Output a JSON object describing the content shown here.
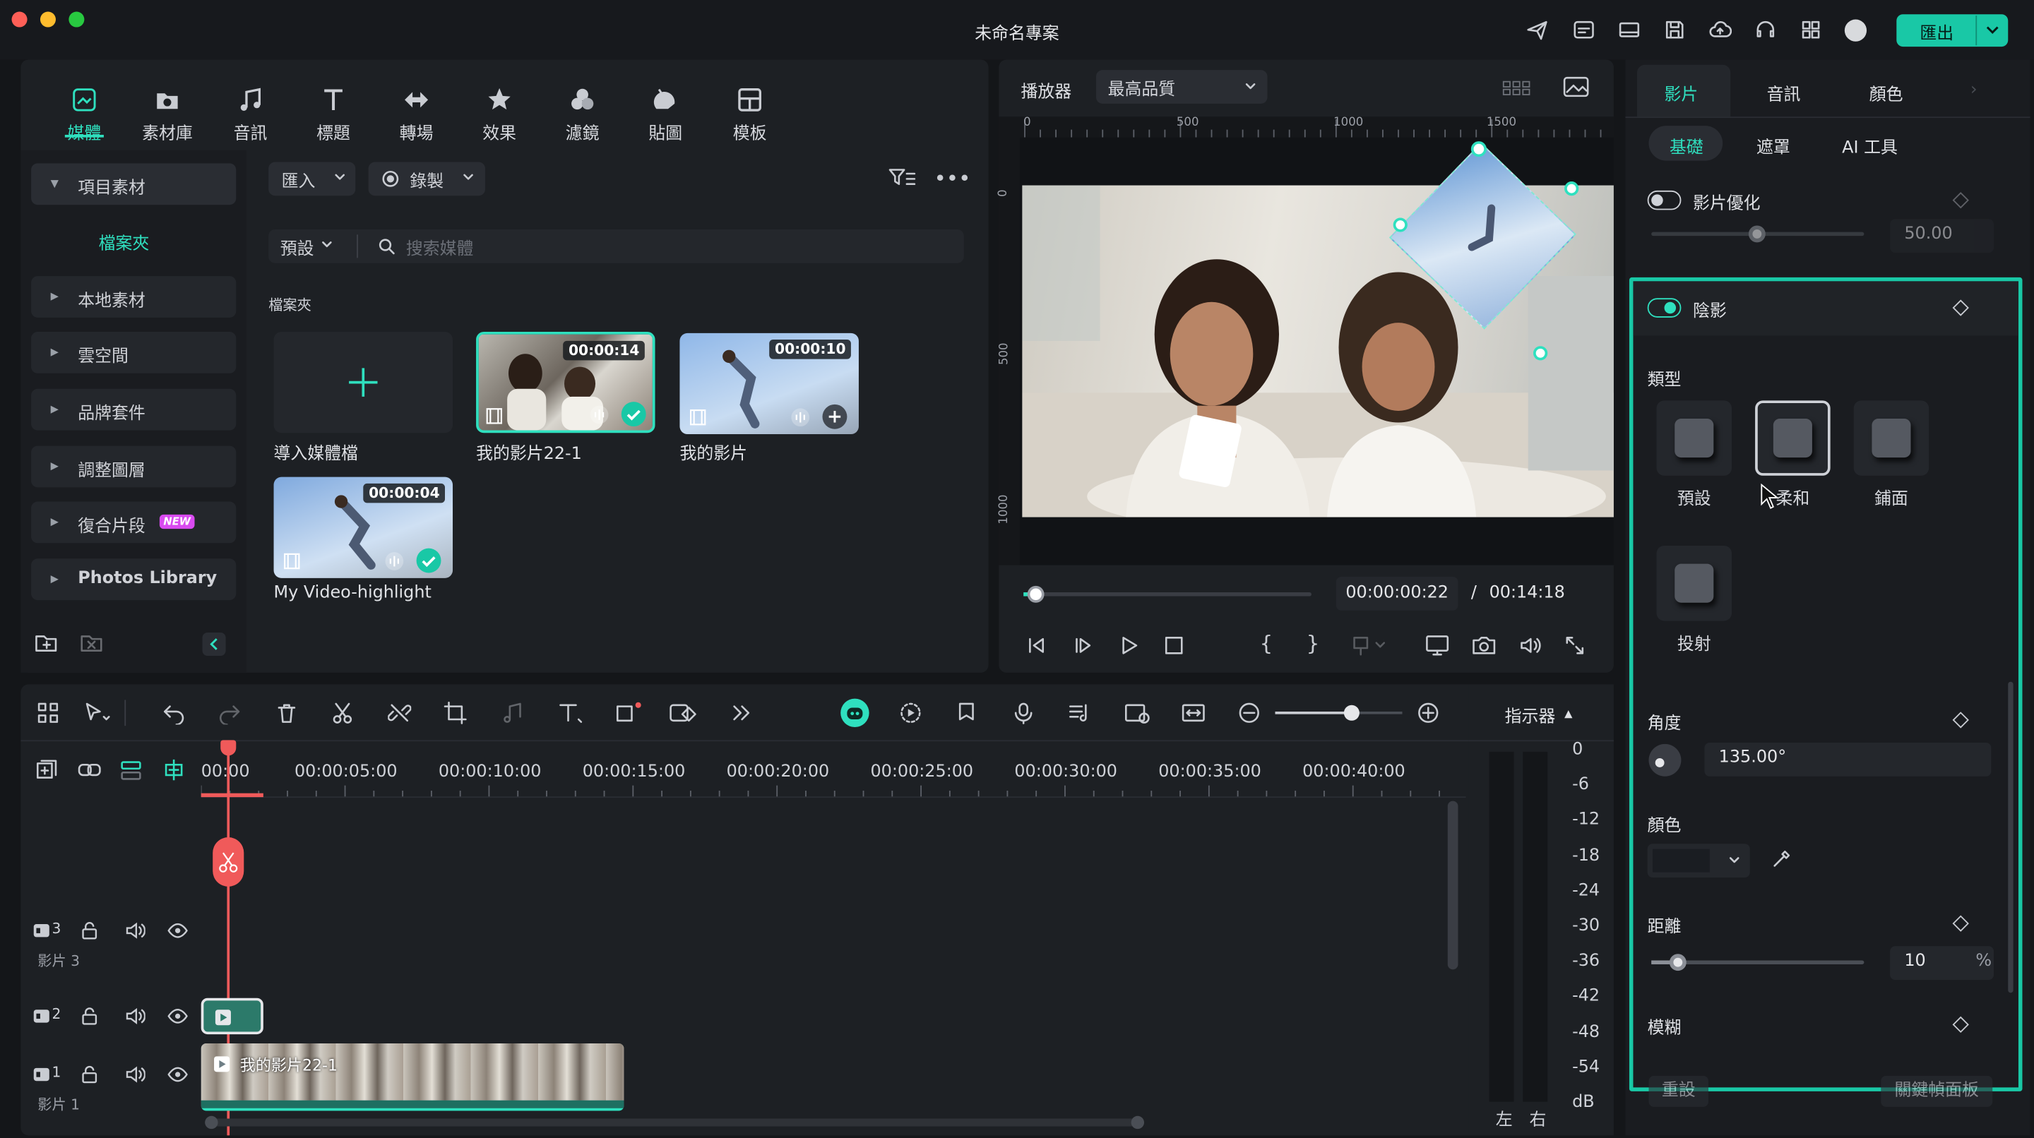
{
  "window": {
    "title": "未命名專案",
    "export_label": "匯出"
  },
  "media_tabs": [
    {
      "label": "媒體",
      "icon": "media-icon"
    },
    {
      "label": "素材庫",
      "icon": "stock-icon"
    },
    {
      "label": "音訊",
      "icon": "music-icon"
    },
    {
      "label": "標題",
      "icon": "title-icon"
    },
    {
      "label": "轉場",
      "icon": "transition-icon"
    },
    {
      "label": "效果",
      "icon": "effects-icon"
    },
    {
      "label": "濾鏡",
      "icon": "filter-icon"
    },
    {
      "label": "貼圖",
      "icon": "sticker-icon"
    },
    {
      "label": "模板",
      "icon": "template-icon"
    }
  ],
  "sidebar": {
    "project_media": "項目素材",
    "folder": "檔案夾",
    "items": [
      "本地素材",
      "雲空間",
      "品牌套件",
      "調整圖層",
      "復合片段",
      "Photos Library"
    ],
    "new_badge": "NEW"
  },
  "media_toolbar": {
    "import": "匯入",
    "record": "錄製",
    "preset": "預設",
    "search_placeholder": "搜索媒體",
    "folder_heading": "檔案夾"
  },
  "media_items": [
    {
      "label": "導入媒體檔",
      "duration": ""
    },
    {
      "label": "我的影片22-1",
      "duration": "00:00:14"
    },
    {
      "label": "我的影片",
      "duration": "00:00:10"
    },
    {
      "label": "My Video-highlight",
      "duration": "00:00:04"
    }
  ],
  "player": {
    "label": "播放器",
    "quality": "最高品質",
    "ruler": [
      "0",
      "500",
      "1000",
      "1500"
    ],
    "vruler": [
      "0",
      "500",
      "1000"
    ],
    "current_time": "00:00:00:22",
    "separator": "/",
    "total_time": "00:14:18",
    "progress": 0.04
  },
  "props": {
    "tabs": [
      "影片",
      "音訊",
      "顏色"
    ],
    "subtabs": [
      "基礎",
      "遮罩",
      "AI 工具"
    ],
    "enhance": "影片優化",
    "enhance_value": "50.00",
    "shadow": "陰影",
    "type_label": "類型",
    "types": [
      "預設",
      "柔和",
      "鋪面",
      "投射"
    ],
    "angle_label": "角度",
    "angle_value": "135.00°",
    "color_label": "顏色",
    "distance_label": "距離",
    "distance_value": "10",
    "distance_unit": "%",
    "blur_label": "模糊",
    "reset": "重設",
    "keyframe_panel": "關鍵幀面板"
  },
  "timeline": {
    "ticks": [
      "00:00",
      "00:00:05:00",
      "00:00:10:00",
      "00:00:15:00",
      "00:00:20:00",
      "00:00:25:00",
      "00:00:30:00",
      "00:00:35:00",
      "00:00:40:00"
    ],
    "tracks": [
      {
        "num": "3",
        "name": "影片 3"
      },
      {
        "num": "2",
        "name": ""
      },
      {
        "num": "1",
        "name": "影片 1"
      }
    ],
    "clip_label": "我的影片22-1",
    "zoom_level": 0.6
  },
  "meter": {
    "label": "指示器",
    "levels": [
      "0",
      "-6",
      "-12",
      "-18",
      "-24",
      "-30",
      "-36",
      "-42",
      "-48",
      "-54",
      "dB"
    ],
    "left": "左",
    "right": "右"
  },
  "colors": {
    "accent": "#19c8a6",
    "playhead": "#f05a5a"
  }
}
